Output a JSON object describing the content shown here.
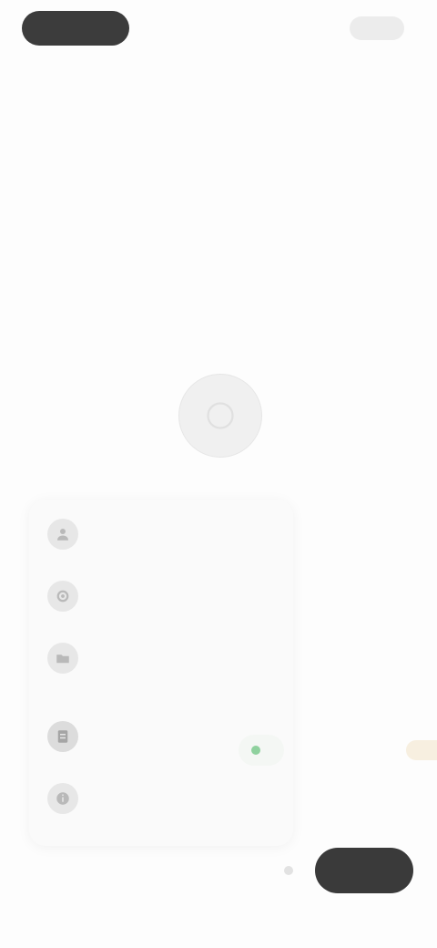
{
  "header": {
    "pill_label": "",
    "right_label": "",
    "title": "",
    "subtitle": ""
  },
  "menu": {
    "items": [
      {
        "label": "",
        "icon": "user-icon"
      },
      {
        "label": "",
        "icon": "settings-icon"
      },
      {
        "label": "",
        "icon": "folder-icon"
      },
      {
        "label": "",
        "icon": "document-icon"
      },
      {
        "label": "",
        "icon": "info-icon"
      }
    ]
  },
  "chip": {
    "label": "",
    "status_color": "#8fd19e"
  },
  "footer": {
    "left_label": "",
    "primary_label": ""
  },
  "colors": {
    "primary_dark": "#3a3a3a",
    "background": "#fdfdfd",
    "accent_green": "#8fd19e"
  }
}
